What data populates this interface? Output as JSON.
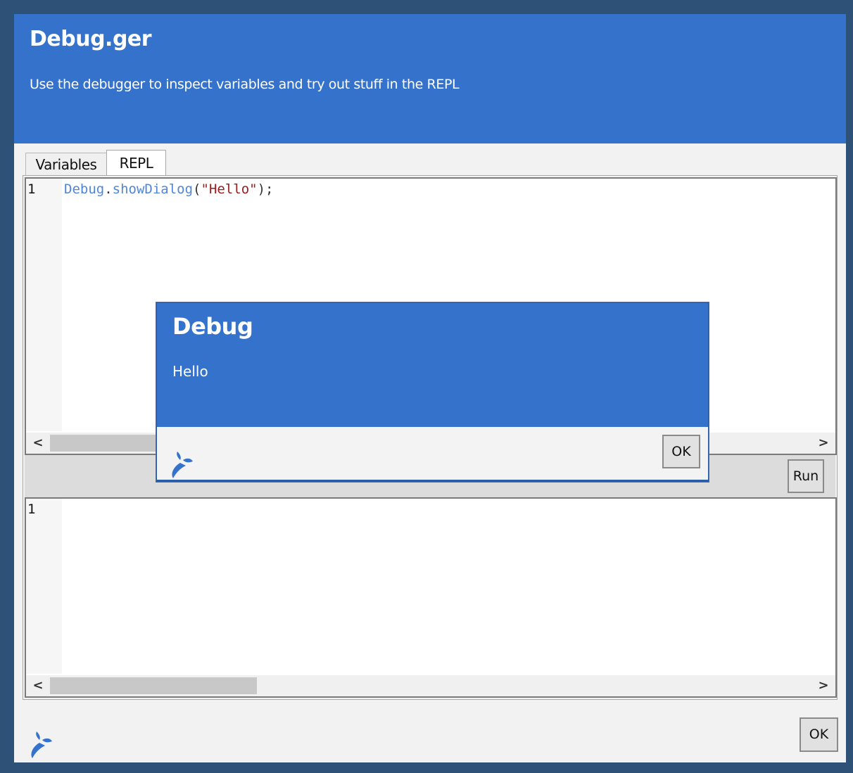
{
  "dialog": {
    "title": "Debug.ger",
    "subtitle": "Use the debugger to inspect variables and try out stuff in the REPL",
    "ok_label": "OK",
    "logo": "app-logo-icon"
  },
  "tabs": [
    {
      "label": "Variables",
      "selected": false
    },
    {
      "label": "REPL",
      "selected": true
    }
  ],
  "repl": {
    "input_editor": {
      "line_number": "1",
      "code_tokens": [
        {
          "text": "Debug",
          "kind": "obj"
        },
        {
          "text": ".",
          "kind": "punct"
        },
        {
          "text": "showDialog",
          "kind": "obj"
        },
        {
          "text": "(",
          "kind": "punct"
        },
        {
          "text": "\"Hello\"",
          "kind": "str"
        },
        {
          "text": ");",
          "kind": "punct"
        }
      ]
    },
    "run_label": "Run",
    "output_editor": {
      "line_number": "1"
    },
    "scroll_arrows": {
      "left": "<",
      "right": ">"
    }
  },
  "popup": {
    "title": "Debug",
    "message": "Hello",
    "ok_label": "OK",
    "logo": "app-logo-icon"
  },
  "colors": {
    "accent": "#3472cc",
    "frame": "#2e5178",
    "code_object": "#4f86d8",
    "code_string": "#9a1b1b"
  }
}
